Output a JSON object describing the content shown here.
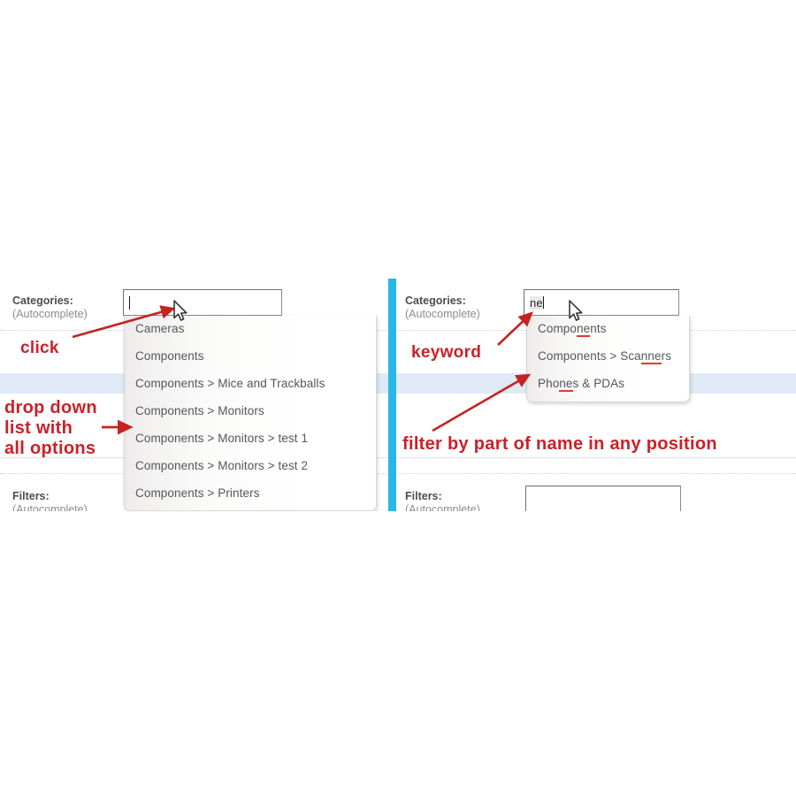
{
  "meta": {
    "accent_red": "#cc2027",
    "divider_blue": "#29b6e8",
    "highlight_blue": "#dfeaf6",
    "underline_red": "#e03a2f"
  },
  "left_panel": {
    "categories_field": {
      "label": "Categories:",
      "sublabel": "(Autocomplete)",
      "value": "",
      "placeholder": ""
    },
    "filters_field": {
      "label": "Filters:",
      "sublabel": "(Autocomplete)",
      "value": ""
    },
    "dropdown": {
      "items": [
        {
          "text": "Cameras"
        },
        {
          "text": "Components"
        },
        {
          "text": "Components > Mice and Trackballs"
        },
        {
          "text": "Components > Monitors"
        },
        {
          "text": "Components > Monitors > test 1"
        },
        {
          "text": "Components > Monitors > test 2"
        },
        {
          "text": "Components > Printers"
        }
      ]
    },
    "annotations": {
      "click": "click",
      "dropdown_line1": "drop down",
      "dropdown_line2": "list with",
      "dropdown_line3": "all options"
    }
  },
  "right_panel": {
    "categories_field": {
      "label": "Categories:",
      "sublabel": "(Autocomplete)",
      "value": "ne",
      "placeholder": ""
    },
    "filters_field": {
      "label": "Filters:",
      "sublabel": "(Autocomplete)",
      "value": ""
    },
    "dropdown": {
      "items": [
        {
          "pre": "Compo",
          "match": "ne",
          "post": "nts"
        },
        {
          "pre": "Components > Sca",
          "match": "nne",
          "post": "rs"
        },
        {
          "pre": "Pho",
          "match": "ne",
          "post": "s & PDAs"
        }
      ]
    },
    "annotations": {
      "keyword": "keyword",
      "filter_note": "filter by part of name in any position"
    }
  },
  "icons": {
    "cursor": "mouse-pointer-icon",
    "arrow": "annotation-arrow-icon"
  }
}
